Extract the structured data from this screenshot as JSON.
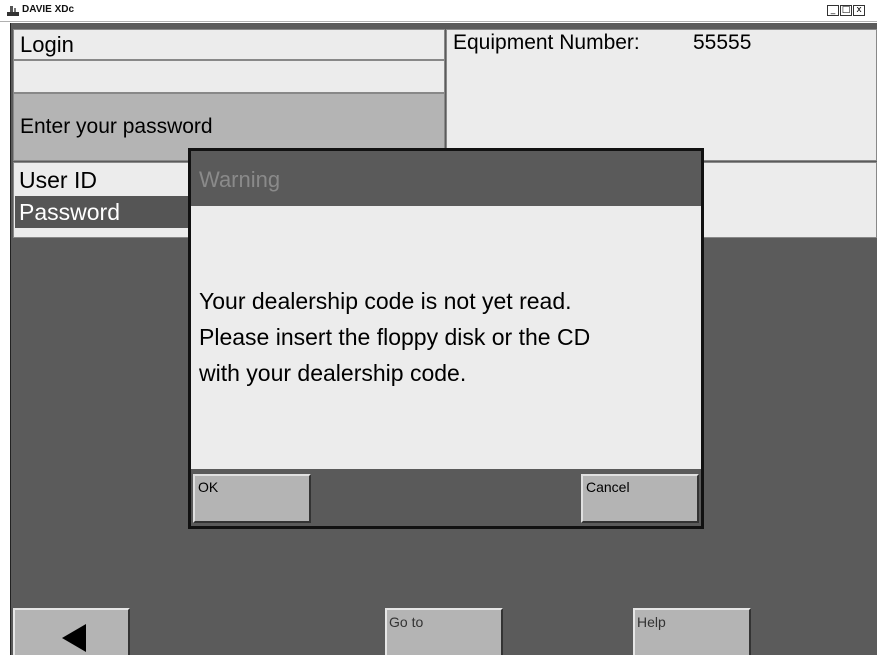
{
  "window": {
    "title": "DAVIE XDc",
    "controls": {
      "minimize": "_",
      "maximize": "□",
      "close": "x"
    }
  },
  "login": {
    "header": "Login",
    "prompt": "Enter your password"
  },
  "equipment": {
    "label": "Equipment Number:",
    "value": "55555"
  },
  "fields": {
    "user_id_label": "User ID",
    "password_label": "Password"
  },
  "dialog": {
    "title": "Warning",
    "message_line1": "Your dealership code is not yet read.",
    "message_line2": "Please insert the floppy disk or the CD",
    "message_line3": "with your dealership code.",
    "ok_label": "OK",
    "cancel_label": "Cancel"
  },
  "nav": {
    "back_icon": "left-arrow-icon",
    "goto_label": "Go to",
    "help_label": "Help"
  }
}
